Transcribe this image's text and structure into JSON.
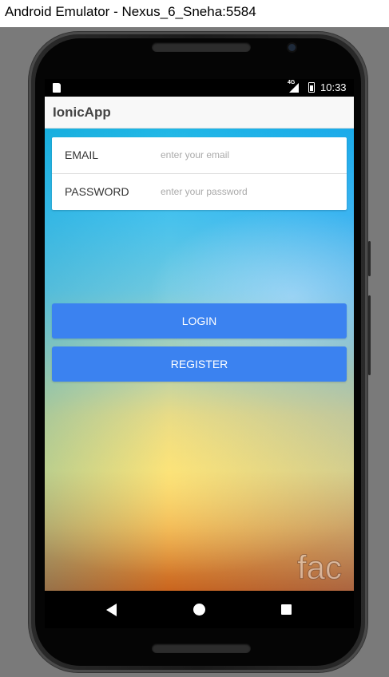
{
  "window": {
    "title": "Android Emulator - Nexus_6_Sneha:5584"
  },
  "status_bar": {
    "network": "4G",
    "time": "10:33"
  },
  "app": {
    "title": "IonicApp",
    "form": {
      "email_label": "EMAIL",
      "email_placeholder": "enter your email",
      "email_value": "",
      "password_label": "PASSWORD",
      "password_placeholder": "enter your password",
      "password_value": ""
    },
    "buttons": {
      "login": "LOGIN",
      "register": "REGISTER"
    },
    "watermark_text": "fac",
    "colors": {
      "primary_button": "#3b82f0",
      "header_bg": "#f8f8f8"
    }
  },
  "icons": {
    "sd_card": "sd-card-icon",
    "signal": "signal-icon",
    "battery": "battery-icon",
    "back": "back-icon",
    "home": "home-icon",
    "recents": "recents-icon"
  }
}
